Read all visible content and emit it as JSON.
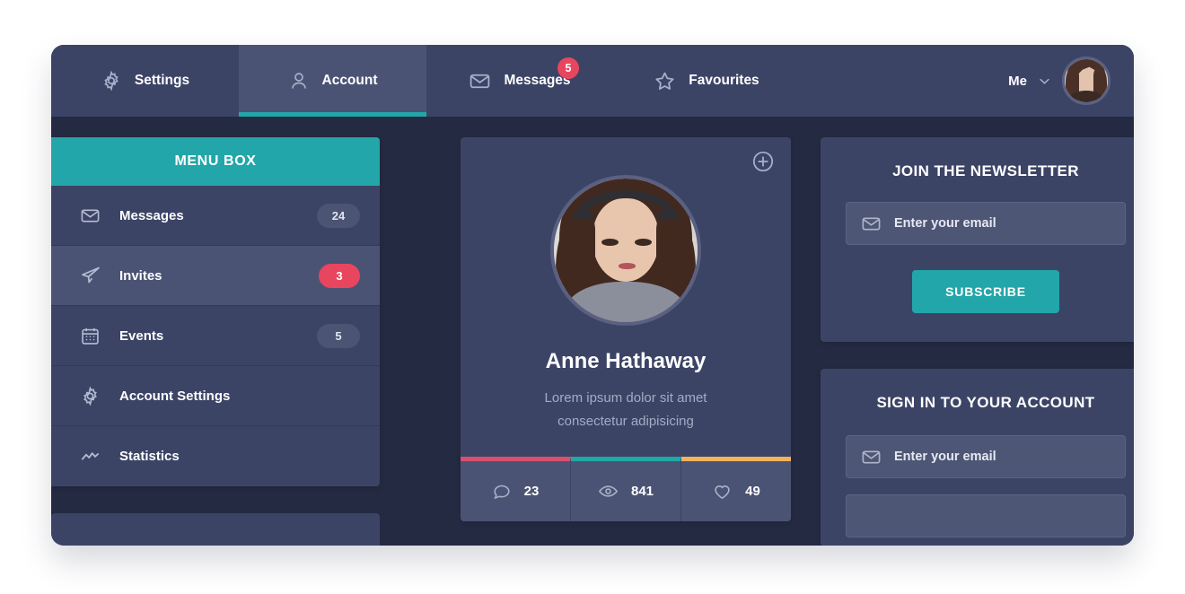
{
  "topnav": {
    "tabs": [
      {
        "label": "Settings",
        "icon": "gear-icon",
        "badge": null
      },
      {
        "label": "Account",
        "icon": "user-icon",
        "badge": null,
        "active": true
      },
      {
        "label": "Messages",
        "icon": "envelope-icon",
        "badge": "5"
      },
      {
        "label": "Favourites",
        "icon": "star-icon",
        "badge": null
      }
    ],
    "user_label": "Me",
    "chevron_icon": "chevron-down-icon",
    "avatar_icon": "avatar"
  },
  "sidebar": {
    "header": "MENU BOX",
    "items": [
      {
        "label": "Messages",
        "icon": "envelope-icon",
        "badge": "24",
        "badge_style": "default",
        "active": false
      },
      {
        "label": "Invites",
        "icon": "paper-plane-icon",
        "badge": "3",
        "badge_style": "red",
        "active": true
      },
      {
        "label": "Events",
        "icon": "calendar-icon",
        "badge": "5",
        "badge_style": "default",
        "active": false
      },
      {
        "label": "Account Settings",
        "icon": "gear-icon",
        "badge": null,
        "badge_style": "none",
        "active": false
      },
      {
        "label": "Statistics",
        "icon": "chart-line-icon",
        "badge": null,
        "badge_style": "none",
        "active": false
      }
    ]
  },
  "profile": {
    "add_icon": "plus-circle-icon",
    "name": "Anne Hathaway",
    "bio_line1": "Lorem ipsum dolor sit amet",
    "bio_line2": "consectetur adipisicing",
    "stats": [
      {
        "icon": "comment-icon",
        "value": "23",
        "color": "#d94f6e"
      },
      {
        "icon": "eye-icon",
        "value": "841",
        "color": "#22a8a5"
      },
      {
        "icon": "heart-icon",
        "value": "49",
        "color": "#f5b25c"
      }
    ]
  },
  "newsletter": {
    "title": "JOIN THE NEWSLETTER",
    "email_placeholder": "Enter your email",
    "email_icon": "envelope-icon",
    "subscribe_label": "SUBSCRIBE"
  },
  "signin": {
    "title": "SIGN IN TO YOUR ACCOUNT",
    "email_placeholder": "Enter your email",
    "email_icon": "envelope-icon",
    "password_placeholder": ""
  },
  "colors": {
    "accent_teal": "#23a6a9",
    "badge_red": "#e8465e",
    "card_bg": "#3c4466",
    "page_bg": "#242a42",
    "row_active": "#4b5374",
    "stat_pink": "#d94f6e",
    "stat_teal": "#22a8a5",
    "stat_orange": "#f5b25c"
  }
}
